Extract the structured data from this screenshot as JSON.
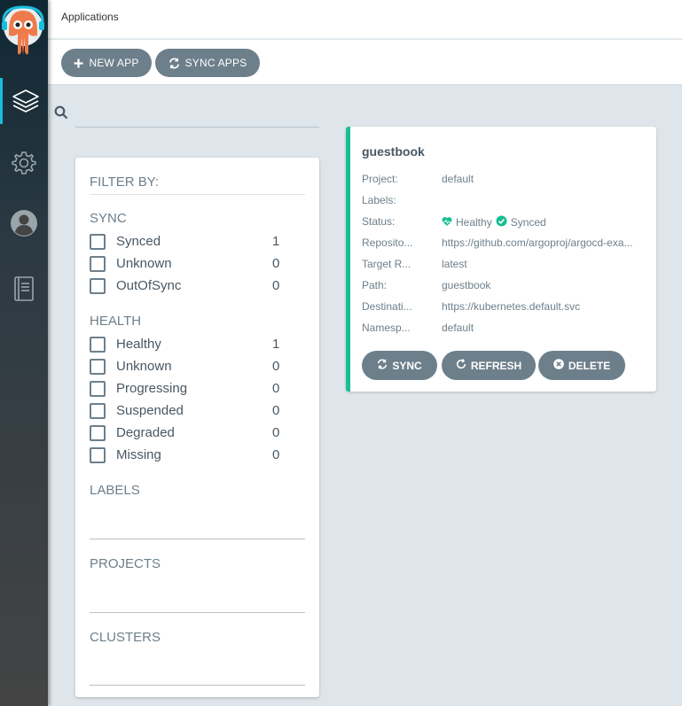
{
  "header": {
    "title": "Applications"
  },
  "toolbar": {
    "new_app_label": "NEW APP",
    "sync_apps_label": "SYNC APPS"
  },
  "search": {
    "placeholder": "",
    "value": ""
  },
  "filter": {
    "title": "FILTER BY:",
    "sync": {
      "title": "SYNC",
      "items": [
        {
          "label": "Synced",
          "count": "1"
        },
        {
          "label": "Unknown",
          "count": "0"
        },
        {
          "label": "OutOfSync",
          "count": "0"
        }
      ]
    },
    "health": {
      "title": "HEALTH",
      "items": [
        {
          "label": "Healthy",
          "count": "1"
        },
        {
          "label": "Unknown",
          "count": "0"
        },
        {
          "label": "Progressing",
          "count": "0"
        },
        {
          "label": "Suspended",
          "count": "0"
        },
        {
          "label": "Degraded",
          "count": "0"
        },
        {
          "label": "Missing",
          "count": "0"
        }
      ]
    },
    "labels_title": "LABELS",
    "projects_title": "PROJECTS",
    "clusters_title": "CLUSTERS"
  },
  "app": {
    "name": "guestbook",
    "fields": {
      "project": {
        "label": "Project:",
        "value": "default"
      },
      "labels": {
        "label": "Labels:",
        "value": ""
      },
      "status": {
        "label": "Status:",
        "health": "Healthy",
        "sync": "Synced"
      },
      "repository": {
        "label": "Reposito...",
        "value": "https://github.com/argoproj/argocd-exa..."
      },
      "target_revision": {
        "label": "Target R...",
        "value": "latest"
      },
      "path": {
        "label": "Path:",
        "value": "guestbook"
      },
      "destination": {
        "label": "Destinati...",
        "value": "https://kubernetes.default.svc"
      },
      "namespace": {
        "label": "Namesp...",
        "value": "default"
      }
    },
    "actions": {
      "sync": "SYNC",
      "refresh": "REFRESH",
      "delete": "DELETE"
    }
  },
  "colors": {
    "accent": "#18bdde",
    "healthy": "#18be94",
    "button": "#6d7f8b"
  },
  "icons": [
    "argo-logo",
    "applications-icon",
    "settings-icon",
    "user-icon",
    "docs-icon",
    "search-icon",
    "plus-icon",
    "sync-icon",
    "refresh-icon",
    "delete-icon",
    "heart-icon",
    "check-circle-icon"
  ]
}
